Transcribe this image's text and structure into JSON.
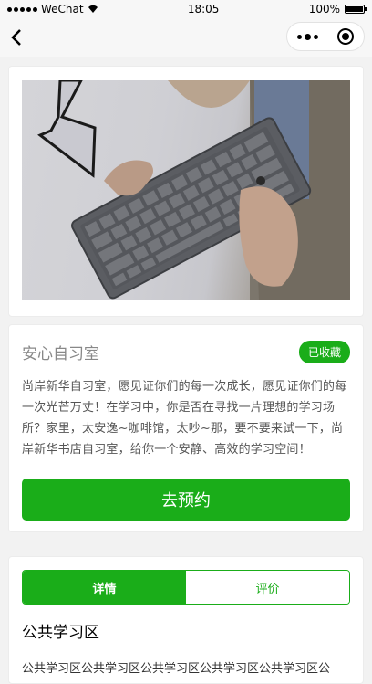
{
  "status_bar": {
    "carrier": "WeChat",
    "time": "18:05",
    "battery": "100%"
  },
  "room": {
    "name": "安心自习室",
    "favorite_badge": "已收藏",
    "description": "尚岸新华自习室，愿见证你们的每一次成长，愿见证你们的每一次光芒万丈！在学习中，你是否在寻找一片理想的学习场所？家里，太安逸~咖啡馆，太吵~那，要不要来试一下，尚岸新华书店自习室，给你一个安静、高效的学习空间！",
    "reserve_label": "去预约"
  },
  "tabs": [
    {
      "label": "详情"
    },
    {
      "label": "评价"
    }
  ],
  "detail": {
    "section_title": "公共学习区",
    "section_text": "公共学习区公共学习区公共学习区公共学习区公共学习区公"
  },
  "colors": {
    "accent": "#1aad19"
  }
}
